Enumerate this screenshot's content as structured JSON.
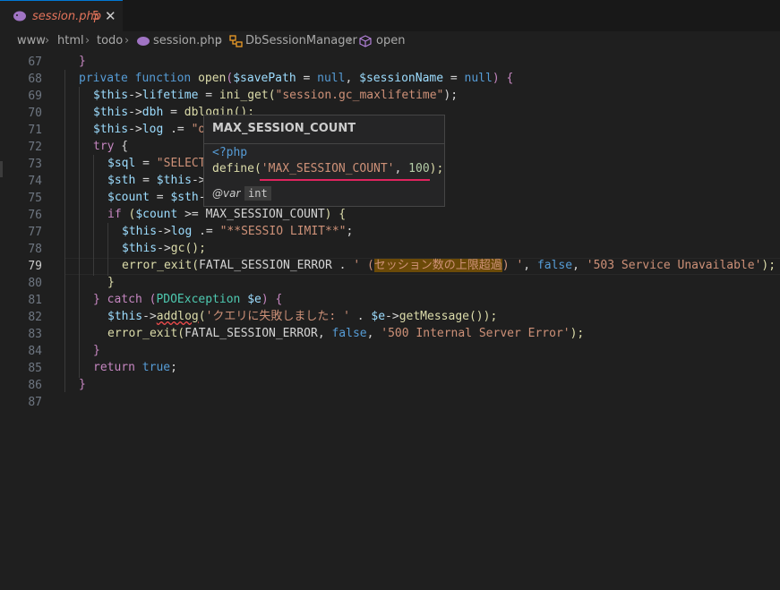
{
  "tab": {
    "filename": "session.php",
    "problem_count": "5",
    "close": "✕",
    "icon": "php-elephant-icon"
  },
  "breadcrumb": {
    "parts": [
      "www",
      "html",
      "todo",
      "session.php",
      "DbSessionManager",
      "open"
    ]
  },
  "line_numbers": [
    "67",
    "68",
    "69",
    "70",
    "71",
    "72",
    "73",
    "74",
    "75",
    "76",
    "77",
    "78",
    "79",
    "80",
    "81",
    "82",
    "83",
    "84",
    "85",
    "86",
    "87"
  ],
  "current_line": "79",
  "code": {
    "l67": "}",
    "l68": [
      "private",
      " ",
      "function",
      " ",
      "open",
      "(",
      "$savePath",
      " = ",
      "null",
      ", ",
      "$sessionName",
      " = ",
      "null",
      ") {"
    ],
    "l69": [
      "$this",
      "->",
      "lifetime",
      " = ",
      "ini_get",
      "(",
      "\"session.gc_maxlifetime\"",
      ");"
    ],
    "l70": [
      "$this",
      "->",
      "dbh",
      " = ",
      "dblogin",
      "();"
    ],
    "l71": [
      "$this",
      "->",
      "log",
      " .= ",
      "\"o"
    ],
    "l72": [
      "try",
      " {"
    ],
    "l73": [
      "$sql",
      " = ",
      "\"SELECT"
    ],
    "l74": [
      "$sth",
      " = ",
      "$this",
      "->"
    ],
    "l75": [
      "$count",
      " = ",
      "$sth",
      "-"
    ],
    "l76": [
      "if",
      " (",
      "$count",
      " >= ",
      "MAX_SESSION_COUNT",
      ") {"
    ],
    "l77": [
      "$this",
      "->",
      "log",
      " .= ",
      "\"**SESSIO LIMIT**\"",
      ";"
    ],
    "l78": [
      "$this",
      "->",
      "gc",
      "();"
    ],
    "l79": [
      "error_exit",
      "(",
      "FATAL_SESSION_ERROR",
      " . ",
      "' (",
      "セッション数の上限超過",
      ") '",
      ", ",
      "false",
      ", ",
      "'503 Service Unavailable'",
      ");"
    ],
    "l80": "}",
    "l81": [
      "}",
      " catch ",
      "(",
      "PDOException",
      " ",
      "$e",
      ") {"
    ],
    "l82": [
      "$this",
      "->",
      "addlog",
      "(",
      "'クエリに失敗しました: '",
      " . ",
      "$e",
      "->",
      "getMessage",
      "());"
    ],
    "l83": [
      "error_exit",
      "(",
      "FATAL_SESSION_ERROR",
      ", ",
      "false",
      ", ",
      "'500 Internal Server Error'",
      ");"
    ],
    "l84": "}",
    "l85": [
      "return",
      " ",
      "true",
      ";"
    ],
    "l86": "}"
  },
  "hover": {
    "title": "MAX_SESSION_COUNT",
    "php_open": "<?php",
    "define_fn": "define",
    "define_paren": "(",
    "define_name": "'MAX_SESSION_COUNT'",
    "define_sep": ", ",
    "define_value": "100",
    "define_close": ");",
    "tag": "@var",
    "tag_type": "int"
  },
  "colors": {
    "accent": "#0078d4",
    "error": "#f14c4c",
    "underline": "#e0245e"
  }
}
